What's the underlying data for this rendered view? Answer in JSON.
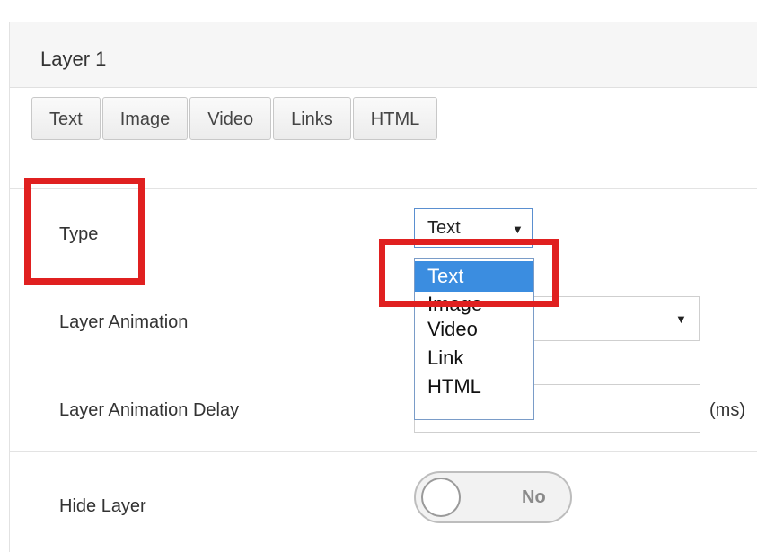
{
  "panel": {
    "title": "Layer 1"
  },
  "tabs": [
    "Text",
    "Image",
    "Video",
    "Links",
    "HTML"
  ],
  "fields": {
    "type": {
      "label": "Type",
      "value": "Text"
    },
    "animation": {
      "label": "Layer Animation",
      "value": ""
    },
    "delay": {
      "label": "Layer Animation Delay",
      "value": "",
      "unit": "(ms)"
    },
    "hide": {
      "label": "Hide Layer",
      "toggle": "No"
    }
  },
  "type_dropdown": {
    "options": [
      "Text",
      "Image",
      "Video",
      "Link",
      "HTML"
    ],
    "selected": "Text"
  },
  "colors": {
    "highlight": "#e02020",
    "selected_option": "#3b8de0"
  }
}
